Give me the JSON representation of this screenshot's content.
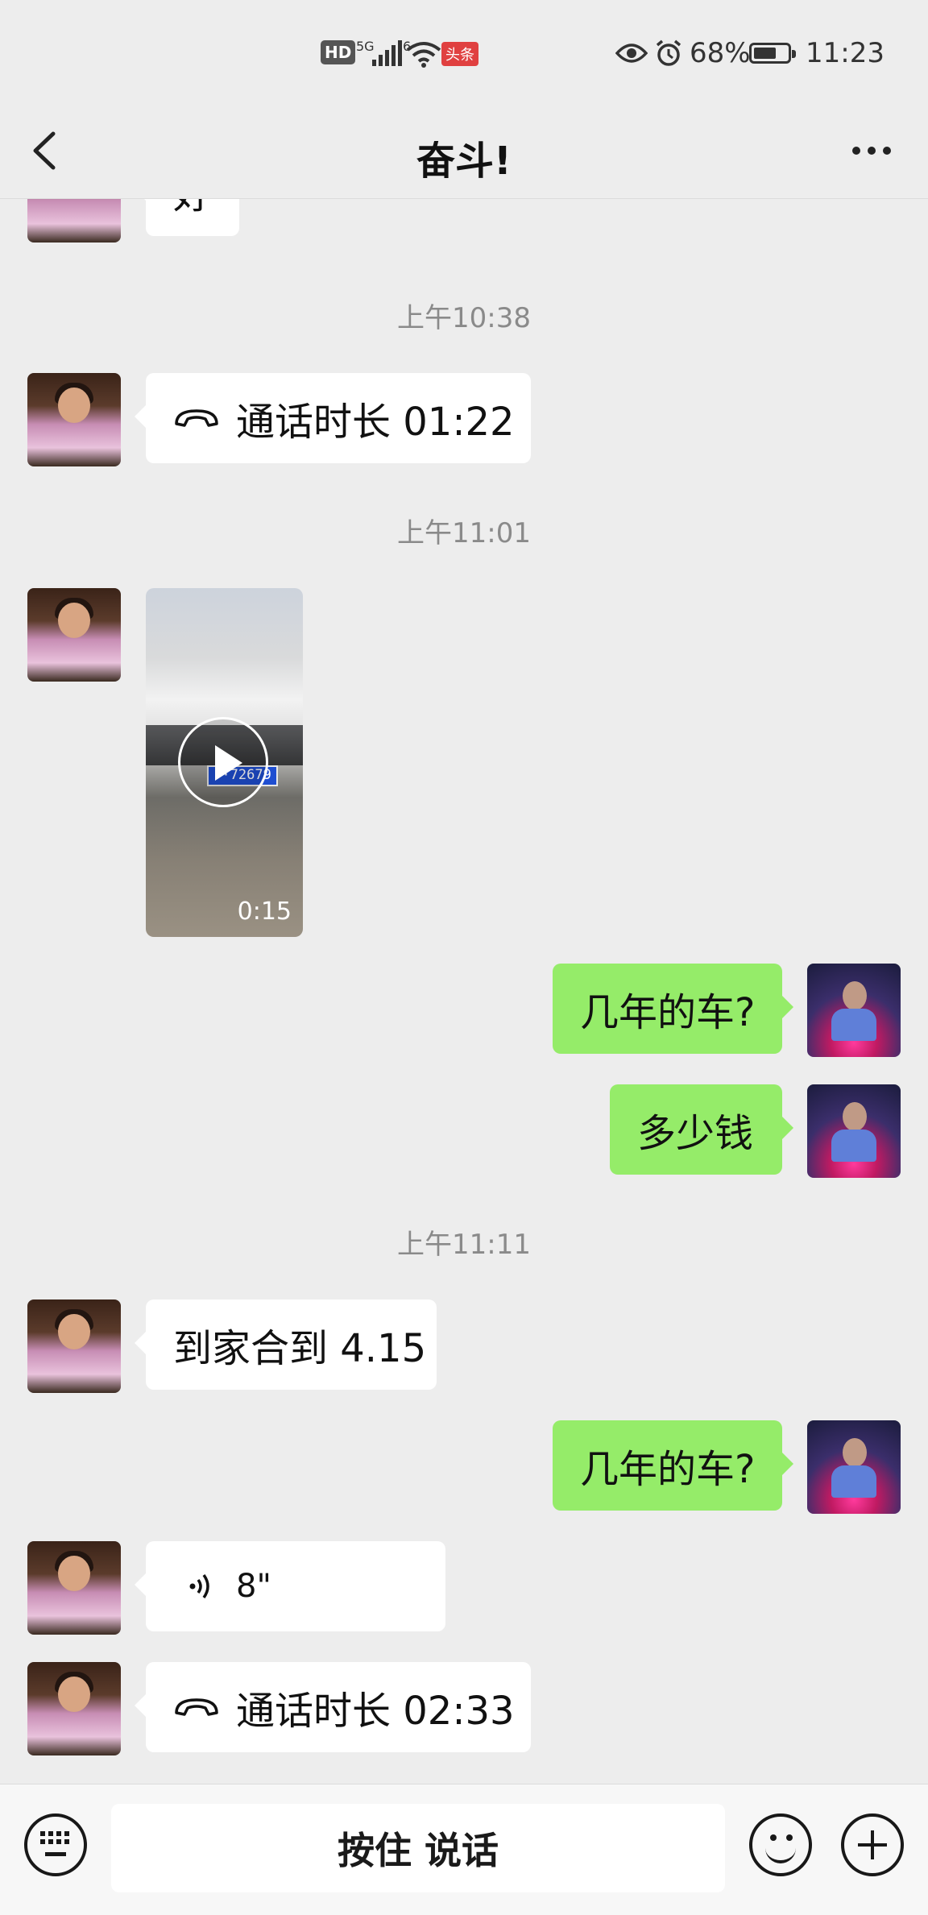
{
  "status_bar": {
    "hd": "HD",
    "net1": "5G",
    "net2": "6",
    "news_badge": "头条",
    "battery_text": "68%",
    "battery_level": 0.68,
    "clock": "11:23"
  },
  "header": {
    "title": "奋斗!"
  },
  "chat": {
    "messages": [
      {
        "side": "left",
        "type": "text",
        "text": "好"
      },
      {
        "type": "time",
        "text": "上午10:38"
      },
      {
        "side": "left",
        "type": "call",
        "text": "通话时长 01:22"
      },
      {
        "type": "time",
        "text": "上午11:01"
      },
      {
        "side": "left",
        "type": "video",
        "plate": "F·72679",
        "duration": "0:15"
      },
      {
        "side": "right",
        "type": "text",
        "text": "几年的车?"
      },
      {
        "side": "right",
        "type": "text",
        "text": "多少钱"
      },
      {
        "type": "time",
        "text": "上午11:11"
      },
      {
        "side": "left",
        "type": "text",
        "text": "到家合到 4.15"
      },
      {
        "side": "right",
        "type": "text",
        "text": "几年的车?"
      },
      {
        "side": "left",
        "type": "voice",
        "text": "8\""
      },
      {
        "side": "left",
        "type": "call",
        "text": "通话时长 02:33"
      }
    ]
  },
  "input_bar": {
    "talk_label": "按住 说话"
  },
  "icons": {
    "back": "chevron-left-icon",
    "more": "ellipsis-icon",
    "call": "phone-handset-icon",
    "voice": "voice-wave-icon",
    "play": "play-icon",
    "keyboard": "keyboard-icon",
    "emoji": "emoji-icon",
    "plus": "plus-icon"
  },
  "colors": {
    "bubble_self": "#95ec69",
    "bubble_other": "#ffffff",
    "background": "#ededed"
  }
}
